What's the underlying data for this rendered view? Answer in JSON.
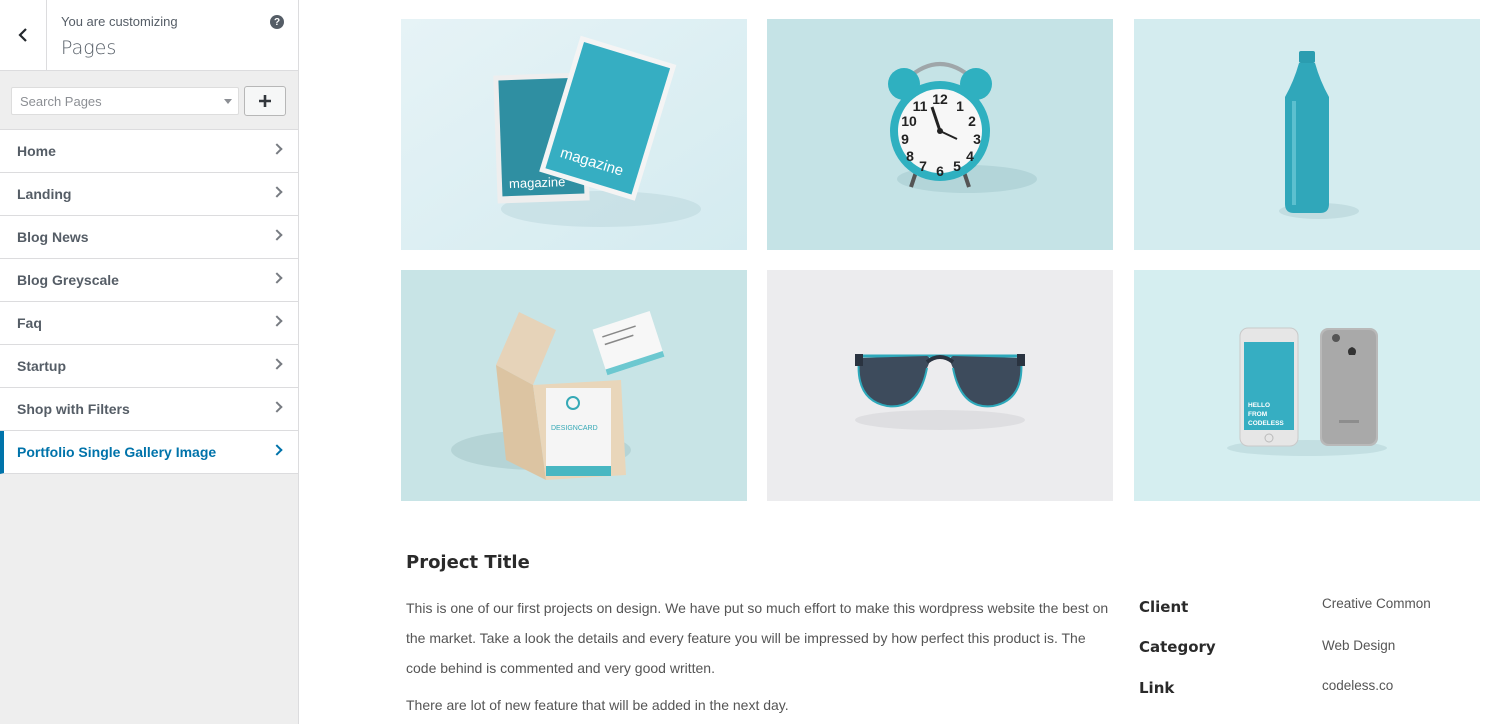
{
  "sidebar": {
    "subtitle": "You are customizing",
    "title": "Pages",
    "search": {
      "placeholder": "Search Pages"
    },
    "items": [
      {
        "label": "Home"
      },
      {
        "label": "Landing"
      },
      {
        "label": "Blog News"
      },
      {
        "label": "Blog Greyscale"
      },
      {
        "label": "Faq"
      },
      {
        "label": "Startup"
      },
      {
        "label": "Shop with Filters"
      },
      {
        "label": "Portfolio Single Gallery Image"
      }
    ],
    "active_index": 7
  },
  "gallery": {
    "magazine_text": "magazine",
    "phone_text": [
      "HELLO",
      "FROM",
      "CODELESS"
    ],
    "business_card_text": "DESIGNCARD"
  },
  "project": {
    "title": "Project Title",
    "description": "This is one of our first projects on design. We have put so much effort to make this wordpress website the best on the market. Take a look the details and every feature you will be impressed by how perfect this product is. The code behind is commented and very good written.",
    "note": "There are lot of new feature that will be added in the next day.",
    "meta": {
      "client_label": "Client",
      "client_value": "Creative Common",
      "category_label": "Category",
      "category_value": "Web Design",
      "link_label": "Link",
      "link_value": "codeless.co"
    }
  },
  "colors": {
    "accent": "#0073aa",
    "teal": "#33a9bd",
    "light_teal": "#cfe8eb"
  },
  "icons": [
    "back-chevron-icon",
    "help-icon",
    "plus-icon",
    "chevron-right-icon"
  ]
}
